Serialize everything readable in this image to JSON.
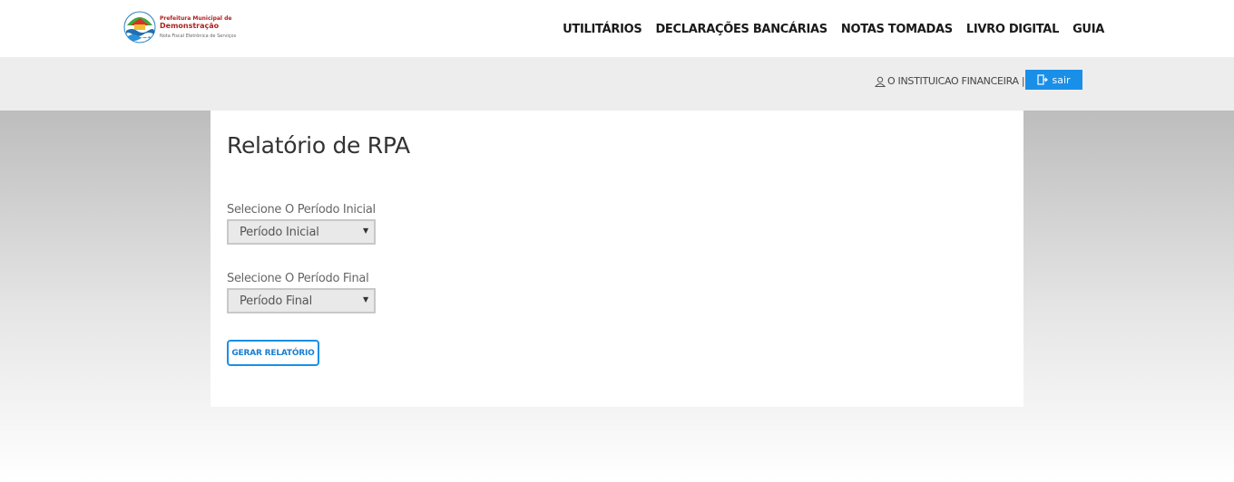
{
  "logo": {
    "line1": "Prefeitura Municipal de",
    "line2": "Demonstração",
    "line3": "Nota Fiscal Eletrônica de Serviços"
  },
  "nav": [
    "UTILITÁRIOS",
    "DECLARAÇÕES BANCÁRIAS",
    "NOTAS TOMADAS",
    "LIVRO DIGITAL",
    "GUIA"
  ],
  "userbar": {
    "user_label": "O INSTITUICAO FINANCEIRA |",
    "logout_label": "sair"
  },
  "report": {
    "title": "Relatório de RPA",
    "initial_label": "Selecione O Período Inicial",
    "initial_value": "Período Inicial",
    "final_label": "Selecione O Período Final",
    "final_value": "Período Final",
    "submit_label": "GERAR RELATÓRIO"
  },
  "colors": {
    "accent": "#1a8fe8",
    "brand_red": "#b02020"
  }
}
